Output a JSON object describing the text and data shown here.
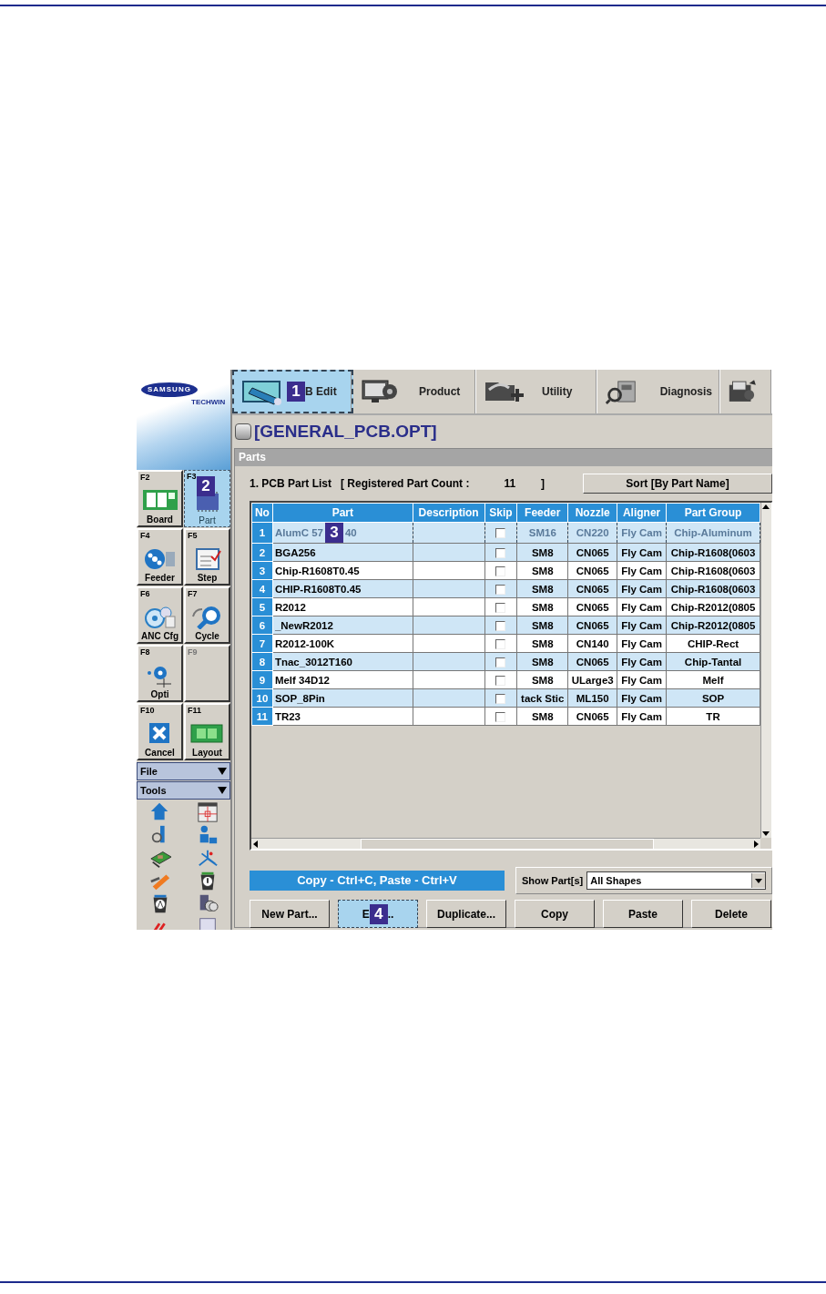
{
  "toolbar": {
    "tabs": [
      {
        "kind": "edit",
        "label": "B Edit",
        "callout": "1",
        "selected": true
      },
      {
        "kind": "product",
        "label": "Product",
        "selected": false
      },
      {
        "kind": "utility",
        "label": "Utility",
        "selected": false
      },
      {
        "kind": "diagnosis",
        "label": "Diagnosis",
        "selected": false
      },
      {
        "kind": "tools",
        "selected": false
      }
    ]
  },
  "file_title": "[GENERAL_PCB.OPT]",
  "sidebar": {
    "logo": {
      "brand": "SAMSUNG",
      "sub": "TECHWIN"
    },
    "function_keys": [
      {
        "key": "F2",
        "label": "Board",
        "kind": "board",
        "selected": false,
        "disabled": false
      },
      {
        "key": "F3",
        "label": "Part",
        "kind": "part",
        "callout": "2",
        "selected": true,
        "disabled": false
      },
      {
        "key": "F4",
        "label": "Feeder",
        "kind": "feeder",
        "selected": false,
        "disabled": false
      },
      {
        "key": "F5",
        "label": "Step",
        "kind": "step",
        "selected": false,
        "disabled": false
      },
      {
        "key": "F6",
        "label": "ANC Cfg",
        "kind": "anc",
        "selected": false,
        "disabled": false
      },
      {
        "key": "F7",
        "label": "Cycle",
        "kind": "cycle",
        "selected": false,
        "disabled": false
      },
      {
        "key": "F8",
        "label": "Opti",
        "kind": "opti",
        "selected": false,
        "disabled": false
      },
      {
        "key": "F9",
        "kind": "empty",
        "selected": false,
        "disabled": true
      },
      {
        "key": "F10",
        "label": "Cancel",
        "kind": "cancel",
        "selected": false,
        "disabled": false
      },
      {
        "key": "F11",
        "label": "Layout",
        "kind": "layout",
        "selected": false,
        "disabled": false
      }
    ],
    "menus": [
      {
        "label": "File",
        "expanded": false
      },
      {
        "label": "Tools",
        "expanded": false
      }
    ]
  },
  "parts": {
    "panel_title": "Parts",
    "list_title": "1. PCB Part List",
    "count_label": "[ Registered Part Count :",
    "count": "11",
    "count_close": "]",
    "sort_button": "Sort [By Part Name]",
    "columns": [
      "No",
      "Part",
      "Description",
      "Skip",
      "Feeder",
      "Nozzle",
      "Aligner",
      "Part Group"
    ],
    "rows": [
      {
        "no": "1",
        "part": "AlumC 57",
        "part_tail": "40",
        "callout": "3",
        "skip": false,
        "feeder": "SM16",
        "nozzle": "CN220",
        "aligner": "Fly Cam",
        "group": "Chip-Aluminum",
        "selected": true
      },
      {
        "no": "2",
        "part": "BGA256",
        "skip": false,
        "feeder": "SM8",
        "nozzle": "CN065",
        "aligner": "Fly Cam",
        "group": "Chip-R1608(0603",
        "selected": false
      },
      {
        "no": "3",
        "part": "Chip-R1608T0.45",
        "skip": false,
        "feeder": "SM8",
        "nozzle": "CN065",
        "aligner": "Fly Cam",
        "group": "Chip-R1608(0603",
        "selected": false
      },
      {
        "no": "4",
        "part": "CHIP-R1608T0.45",
        "skip": false,
        "feeder": "SM8",
        "nozzle": "CN065",
        "aligner": "Fly Cam",
        "group": "Chip-R1608(0603",
        "selected": false
      },
      {
        "no": "5",
        "part": "R2012",
        "skip": false,
        "feeder": "SM8",
        "nozzle": "CN065",
        "aligner": "Fly Cam",
        "group": "Chip-R2012(0805",
        "selected": false
      },
      {
        "no": "6",
        "part": "_NewR2012",
        "skip": false,
        "feeder": "SM8",
        "nozzle": "CN065",
        "aligner": "Fly Cam",
        "group": "Chip-R2012(0805",
        "selected": false
      },
      {
        "no": "7",
        "part": "R2012-100K",
        "skip": false,
        "feeder": "SM8",
        "nozzle": "CN140",
        "aligner": "Fly Cam",
        "group": "CHIP-Rect",
        "selected": false
      },
      {
        "no": "8",
        "part": "Tnac_3012T160",
        "skip": false,
        "feeder": "SM8",
        "nozzle": "CN065",
        "aligner": "Fly Cam",
        "group": "Chip-Tantal",
        "selected": false
      },
      {
        "no": "9",
        "part": "Melf 34D12",
        "skip": false,
        "feeder": "SM8",
        "nozzle": "ULarge3",
        "aligner": "Fly Cam",
        "group": "Melf",
        "selected": false
      },
      {
        "no": "10",
        "part": "SOP_8Pin",
        "skip": false,
        "feeder": "tack Stic",
        "nozzle": "ML150",
        "aligner": "Fly Cam",
        "group": "SOP",
        "selected": false
      },
      {
        "no": "11",
        "part": "TR23",
        "skip": false,
        "feeder": "SM8",
        "nozzle": "CN065",
        "aligner": "Fly Cam",
        "group": "TR",
        "selected": false
      }
    ],
    "hint": "Copy - Ctrl+C,  Paste - Ctrl+V",
    "show_label": "Show Part[s]",
    "show_value": "All Shapes",
    "buttons": [
      {
        "label": "New Part...",
        "selected": false
      },
      {
        "label": "E",
        "label_tail": "..",
        "callout": "4",
        "selected": true
      },
      {
        "label": "Duplicate...",
        "selected": false
      },
      {
        "label": "Copy",
        "selected": false
      },
      {
        "label": "Paste",
        "selected": false
      },
      {
        "label": "Delete",
        "selected": false
      }
    ]
  }
}
